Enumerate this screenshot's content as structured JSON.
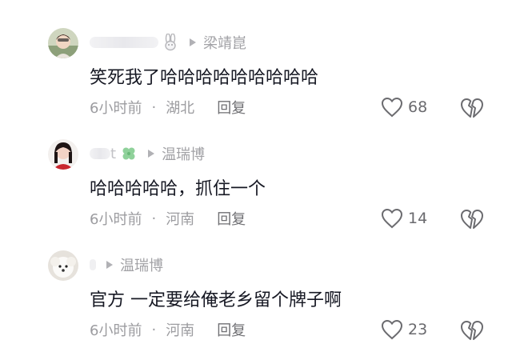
{
  "comments": [
    {
      "user": "",
      "reply_to": "梁靖崑",
      "text": "笑死我了哈哈哈哈哈哈哈哈哈",
      "time": "6小时前",
      "location": "湖北",
      "reply_label": "回复",
      "likes": "68"
    },
    {
      "user": "t",
      "reply_to": "温瑞博",
      "text": "哈哈哈哈哈，抓住一个",
      "time": "6小时前",
      "location": "河南",
      "reply_label": "回复",
      "likes": "14"
    },
    {
      "user": "",
      "reply_to": "温瑞博",
      "text": "官方 一定要给俺老乡留个牌子啊",
      "time": "6小时前",
      "location": "河南",
      "reply_label": "回复",
      "likes": "23"
    }
  ],
  "separator": "·",
  "icons": {
    "badge_1": "rabbit-icon",
    "badge_2": "four-leaf-clover-icon",
    "reply_arrow": "play-triangle-icon",
    "like": "heart-outline-icon",
    "dislike": "broken-heart-icon"
  },
  "colors": {
    "text": "#161823",
    "muted": "#9c9ca0",
    "reply": "#6f6f73",
    "clover": "#7ec48a"
  }
}
